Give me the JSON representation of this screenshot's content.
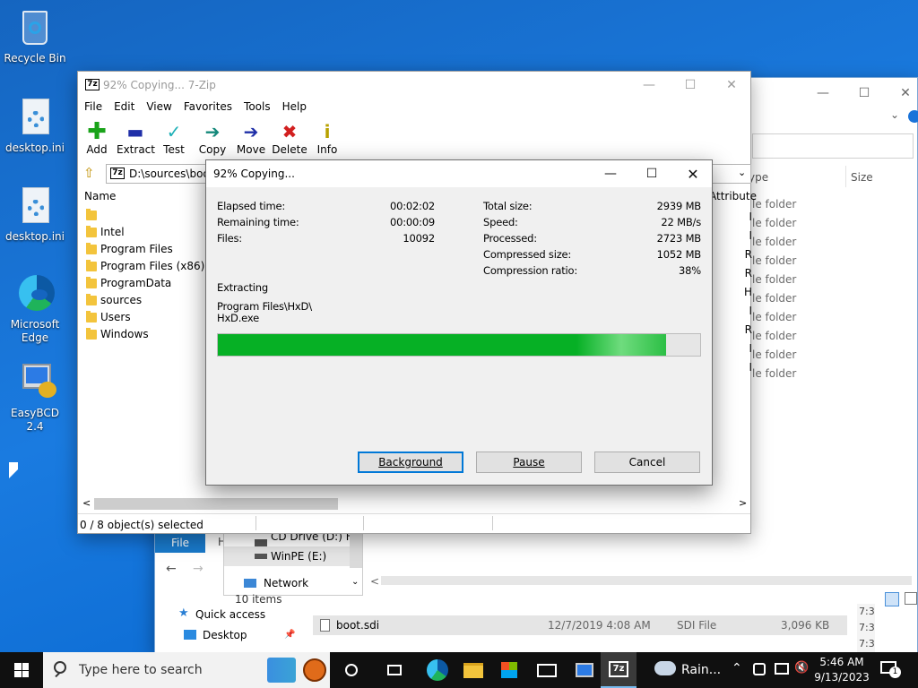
{
  "desktop": {
    "icons": [
      {
        "label": "Recycle Bin"
      },
      {
        "label": "desktop.ini"
      },
      {
        "label": "desktop.ini"
      },
      {
        "label": "Microsoft Edge"
      },
      {
        "label": "EasyBCD 2.4"
      }
    ]
  },
  "explorer": {
    "tab_file": "File",
    "tab_h": "H",
    "header_type": "ype",
    "header_size": "Size",
    "header_attr": "Attribute",
    "type_rows": [
      "le folder",
      "le folder",
      "le folder",
      "le folder",
      "le folder",
      "le folder",
      "le folder",
      "le folder",
      "le folder",
      "le folder"
    ],
    "nav": [
      "CD Drive (D:) HB",
      "WinPE (E:)",
      "Network"
    ],
    "quick_access": "Quick access",
    "desktop_item": "Desktop",
    "items_count": "10 items",
    "file_row": {
      "name": "boot.sdi",
      "date": "12/7/2019 4:08 AM",
      "type": "SDI File",
      "size": "3,096 KB"
    },
    "time_frag": "7:3"
  },
  "sevenzip": {
    "title": "92% Copying... 7-Zip",
    "menu": [
      "File",
      "Edit",
      "View",
      "Favorites",
      "Tools",
      "Help"
    ],
    "toolbar": [
      {
        "label": "Add",
        "icon": "plus-icon",
        "color": "#1aa31a"
      },
      {
        "label": "Extract",
        "icon": "minus-icon",
        "color": "#1f2fa8"
      },
      {
        "label": "Test",
        "icon": "check-icon",
        "color": "#1db0b7"
      },
      {
        "label": "Copy",
        "icon": "arrow-right-icon",
        "color": "#14887a"
      },
      {
        "label": "Move",
        "icon": "arrow-right-icon",
        "color": "#1f2fa8"
      },
      {
        "label": "Delete",
        "icon": "x-icon",
        "color": "#d21f1f"
      },
      {
        "label": "Info",
        "icon": "info-icon",
        "color": "#b8a100"
      }
    ],
    "path": "D:\\sources\\boot",
    "column_name": "Name",
    "files": [
      "",
      "Intel",
      "Program Files",
      "Program Files (x86)",
      "ProgramData",
      "sources",
      "Users",
      "Windows"
    ],
    "status": "0 / 8 object(s) selected"
  },
  "progress": {
    "title": "92% Copying...",
    "elapsed_label": "Elapsed time:",
    "elapsed": "00:02:02",
    "remaining_label": "Remaining time:",
    "remaining": "00:00:09",
    "files_label": "Files:",
    "files": "10092",
    "total_label": "Total size:",
    "total": "2939 MB",
    "speed_label": "Speed:",
    "speed": "22 MB/s",
    "processed_label": "Processed:",
    "processed": "2723 MB",
    "compressed_label": "Compressed size:",
    "compressed": "1052 MB",
    "ratio_label": "Compression ratio:",
    "ratio": "38%",
    "action": "Extracting",
    "path_line1": "Program Files\\HxD\\",
    "path_line2": "HxD.exe",
    "fraction": 0.93,
    "buttons": {
      "background": "Background",
      "pause": "Pause",
      "cancel": "Cancel"
    }
  },
  "taskbar": {
    "search_placeholder": "Type here to search",
    "weather": "Rain...",
    "time": "5:46 AM",
    "date": "9/13/2023",
    "notif_count": "1"
  },
  "colors": {
    "progress_fill": "#06b025",
    "taskbar": "#101010",
    "accent": "#0078d7"
  }
}
